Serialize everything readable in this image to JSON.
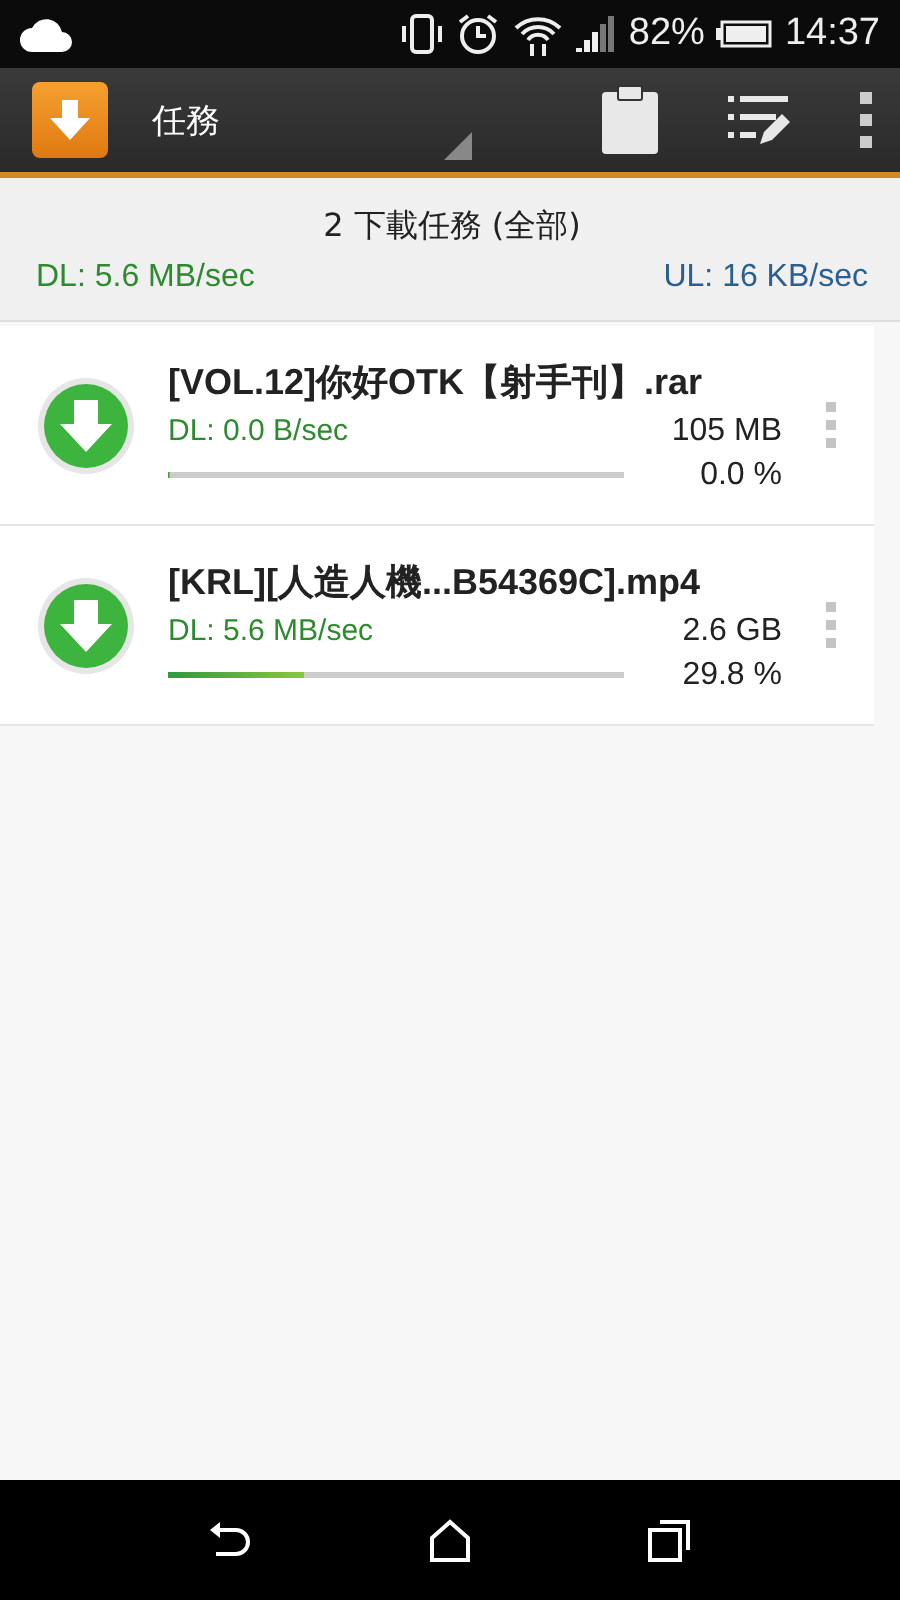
{
  "status_bar": {
    "battery": "82%",
    "time": "14:37"
  },
  "toolbar": {
    "title": "任務"
  },
  "summary": {
    "title": "2 下載任務 (全部)",
    "download_speed": "DL: 5.6 MB/sec",
    "upload_speed": "UL: 16 KB/sec"
  },
  "tasks": [
    {
      "name": "[VOL.12]你好OTK【射手刊】.rar",
      "speed": "DL: 0.0 B/sec",
      "size": "105 MB",
      "level": 0.0,
      "percent": "0.0 %"
    },
    {
      "name": "[KRL][人造人機...B54369C].mp4",
      "speed": "DL: 5.6 MB/sec",
      "size": "2.6 GB",
      "level": 0.298,
      "percent": "29.8 %"
    }
  ]
}
